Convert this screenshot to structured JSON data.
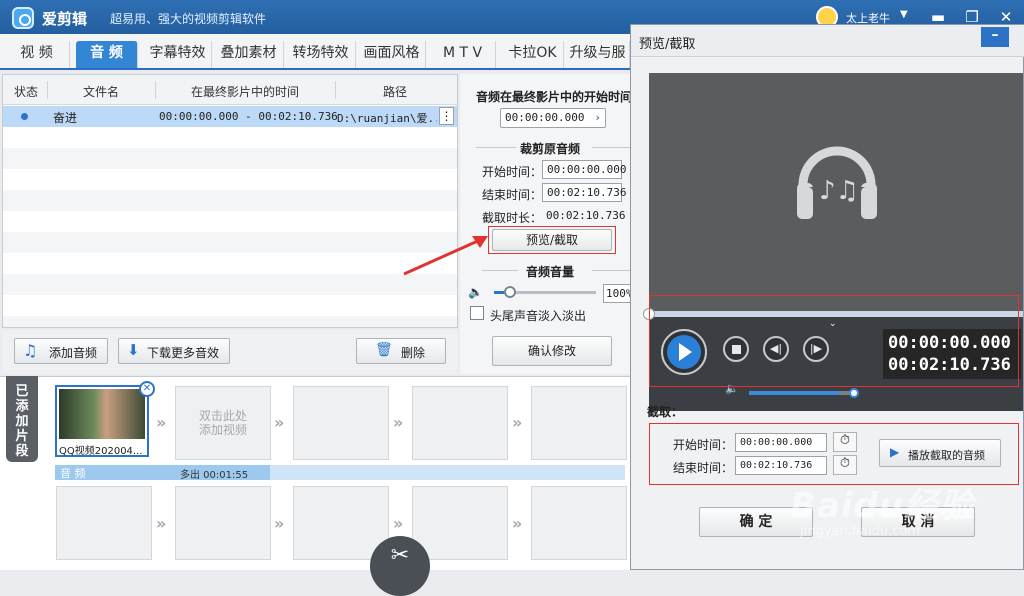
{
  "app": {
    "name": "爱剪辑",
    "slogan": "超易用、强大的视频剪辑软件",
    "user": "太上老牛"
  },
  "tabs": [
    "视 频",
    "音 频",
    "字幕特效",
    "叠加素材",
    "转场特效",
    "画面风格",
    "M T V",
    "卡拉OK",
    "升级与服"
  ],
  "audio_list": {
    "columns": [
      "状态",
      "文件名",
      "在最终影片中的时间",
      "路径"
    ],
    "rows": [
      {
        "name": "奋进",
        "time": "00:00:00.000 - 00:02:10.736",
        "path": "D:\\ruanjian\\爱..."
      }
    ],
    "more_icon": "⋮"
  },
  "list_buttons": {
    "add_audio": "添加音频",
    "download_more": "下载更多音效",
    "delete": "删除"
  },
  "settings": {
    "start_in_final_label": "音频在最终影片中的开始时间",
    "start_in_final_value": "00:00:00.000",
    "crop_section": "裁剪原音频",
    "start_label": "开始时间：",
    "start_value": "00:00:00.000",
    "end_label": "结束时间：",
    "end_value": "00:02:10.736",
    "duration_label": "截取时长：",
    "duration_value": "00:02:10.736",
    "preview_button": "预览/截取",
    "volume_section": "音频音量",
    "volume_value": "100%",
    "fade_label": "头尾声音淡入淡出",
    "confirm_button": "确认修改"
  },
  "clips": {
    "tab_label": "已添加片段",
    "first_clip_name": "QQ视频202004...",
    "add_hint_line1": "双击此处",
    "add_hint_line2": "添加视频",
    "audio_label": "音 频",
    "audio_extra": "多出 00:01:55"
  },
  "dialog": {
    "title": "预览/截取",
    "current_time": "00:00:00.000",
    "total_time": "00:02:10.736",
    "crop_heading": "截取：",
    "start_label": "开始时间：",
    "start_value": "00:00:00.000",
    "end_label": "结束时间：",
    "end_value": "00:02:10.736",
    "play_crop_button": "播放截取的音频",
    "ok_button": "确 定",
    "cancel_button": "取 消",
    "volume_level": 0.83,
    "progress": 0
  },
  "watermark": {
    "text": "Baidu经验",
    "sub": "jingyan.baidu.com"
  },
  "colors": {
    "title_blue": "#2b6db3",
    "accent_blue": "#3386d4",
    "annotation_red": "#e23333"
  }
}
